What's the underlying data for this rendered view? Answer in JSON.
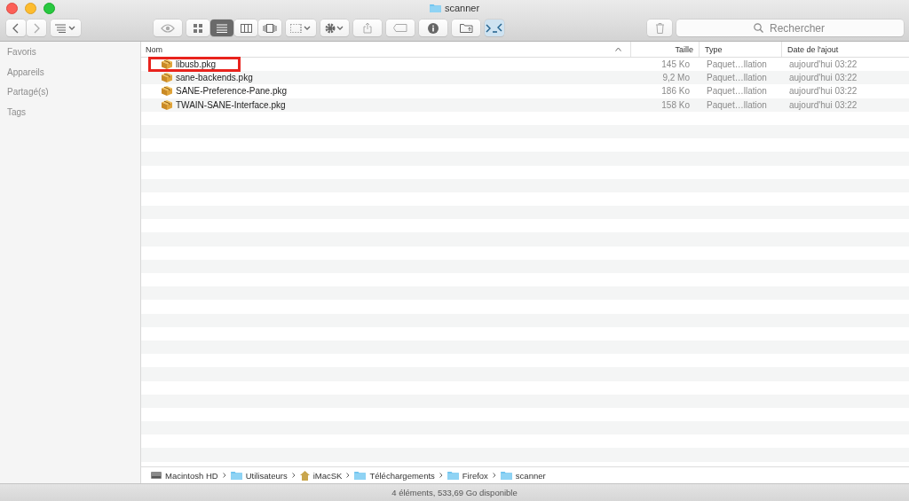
{
  "window": {
    "title": "scanner"
  },
  "toolbar": {
    "buttons": [
      {
        "kind": "back",
        "selected": false
      },
      {
        "kind": "forward",
        "selected": false
      },
      {
        "kind": "arrange",
        "selected": false
      },
      {
        "kind": "quicklook",
        "selected": false
      },
      {
        "kind": "icons",
        "selected": false
      },
      {
        "kind": "list",
        "selected": true
      },
      {
        "kind": "columns",
        "selected": false
      },
      {
        "kind": "coverflow",
        "selected": false
      },
      {
        "kind": "group",
        "selected": false
      },
      {
        "kind": "action",
        "selected": false
      },
      {
        "kind": "share",
        "selected": false
      },
      {
        "kind": "tag",
        "selected": false
      },
      {
        "kind": "info",
        "selected": false
      },
      {
        "kind": "newfolder",
        "selected": false
      },
      {
        "kind": "terminal",
        "selected": false
      },
      {
        "kind": "trash",
        "selected": false
      }
    ],
    "search": {
      "placeholder": "Rechercher"
    }
  },
  "sidebar": {
    "items": [
      {
        "label": "Favoris"
      },
      {
        "label": "Appareils"
      },
      {
        "label": "Partagé(s)"
      },
      {
        "label": "Tags"
      }
    ]
  },
  "table": {
    "columns": [
      {
        "label": "Nom",
        "sorted": true
      },
      {
        "label": "Taille",
        "sorted": false
      },
      {
        "label": "Type",
        "sorted": false
      },
      {
        "label": "Date de l'ajout",
        "sorted": false
      }
    ],
    "rows": [
      {
        "name": "libusb.pkg",
        "size": "145 Ko",
        "type": "Paquet…llation",
        "date": "aujourd'hui 03:22",
        "highlighted": true
      },
      {
        "name": "sane-backends.pkg",
        "size": "9,2 Mo",
        "type": "Paquet…llation",
        "date": "aujourd'hui 03:22",
        "highlighted": false
      },
      {
        "name": "SANE-Preference-Pane.pkg",
        "size": "186 Ko",
        "type": "Paquet…llation",
        "date": "aujourd'hui 03:22",
        "highlighted": false
      },
      {
        "name": "TWAIN-SANE-Interface.pkg",
        "size": "158 Ko",
        "type": "Paquet…llation",
        "date": "aujourd'hui 03:22",
        "highlighted": false
      }
    ]
  },
  "path_bar": [
    {
      "label": "Macintosh HD",
      "kind": "disk"
    },
    {
      "label": "Utilisateurs",
      "kind": "folder"
    },
    {
      "label": "iMacSK",
      "kind": "home"
    },
    {
      "label": "Téléchargements",
      "kind": "folder"
    },
    {
      "label": "Firefox",
      "kind": "folder"
    },
    {
      "label": "scanner",
      "kind": "folder"
    }
  ],
  "status_bar": "4 éléments, 533,69 Go disponible"
}
